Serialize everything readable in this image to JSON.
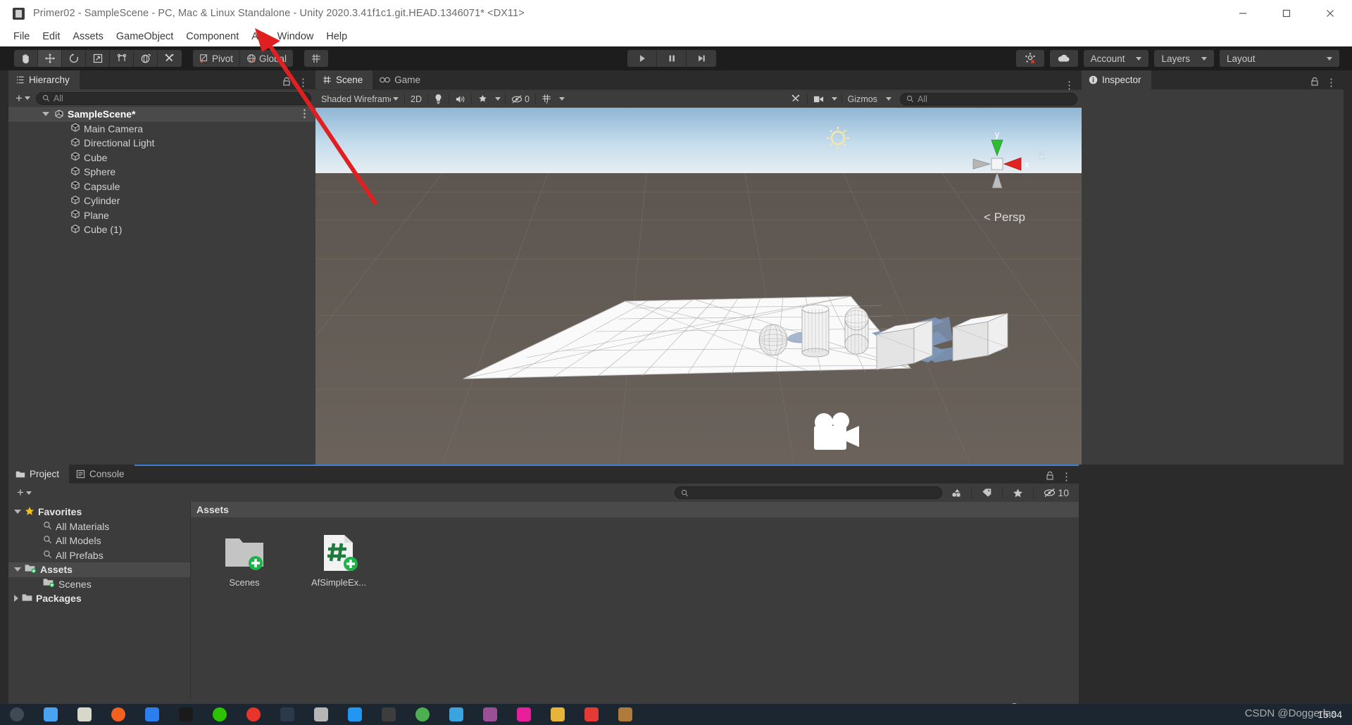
{
  "window": {
    "title": "Primer02 - SampleScene - PC, Mac & Linux Standalone - Unity 2020.3.41f1c1.git.HEAD.1346071* <DX11>",
    "minimize": "—",
    "maximize": "□",
    "close": "✕"
  },
  "menubar": {
    "items": [
      "File",
      "Edit",
      "Assets",
      "GameObject",
      "Component",
      "AF",
      "Window",
      "Help"
    ]
  },
  "toolbar": {
    "tools": [
      {
        "name": "hand-tool",
        "glyph": "✋",
        "active": false
      },
      {
        "name": "move-tool",
        "glyph": "✥",
        "active": true
      },
      {
        "name": "rotate-tool",
        "glyph": "↺",
        "active": false
      },
      {
        "name": "scale-tool",
        "glyph": "⤡",
        "active": false
      },
      {
        "name": "rect-tool",
        "glyph": "□",
        "active": false
      },
      {
        "name": "transform-tool",
        "glyph": "⊕",
        "active": false
      },
      {
        "name": "custom-tool",
        "glyph": "⚒",
        "active": false
      }
    ],
    "pivot_label": "Pivot",
    "global_label": "Global",
    "grid_snap_label": "",
    "play_label": "▶",
    "pause_label": "‖",
    "step_label": "▶|",
    "collab_label": "",
    "cloud_label": "",
    "account_label": "Account",
    "layers_label": "Layers",
    "layout_label": "Layout"
  },
  "hierarchy": {
    "tab_label": "Hierarchy",
    "search_placeholder": "All",
    "add_label": "+",
    "scene_name": "SampleScene*",
    "objects": [
      "Main Camera",
      "Directional Light",
      "Cube",
      "Sphere",
      "Capsule",
      "Cylinder",
      "Plane",
      "Cube (1)"
    ]
  },
  "scene": {
    "tabs": [
      {
        "label": "Scene",
        "icon": "grid-icon",
        "active": true
      },
      {
        "label": "Game",
        "icon": "gamepad-icon",
        "active": false
      }
    ],
    "draw_mode": "Shaded Wireframe",
    "mode_2d": "2D",
    "gizmo_count": "0",
    "gizmos_label": "Gizmos",
    "search_placeholder": "All",
    "axis_y_label": "y",
    "axis_x_label": "x",
    "perspective_label": "< Persp"
  },
  "inspector": {
    "tab_label": "Inspector"
  },
  "project": {
    "tabs": [
      {
        "label": "Project",
        "icon": "folder-icon",
        "active": true
      },
      {
        "label": "Console",
        "icon": "console-icon",
        "active": false
      }
    ],
    "add_label": "+",
    "search_placeholder": "",
    "visible_count": "10",
    "tree": [
      {
        "label": "Favorites",
        "depth": 0,
        "icon": "star-icon",
        "expanded": true,
        "bold": true,
        "selected": false
      },
      {
        "label": "All Materials",
        "depth": 1,
        "icon": "search-icon",
        "expanded": null,
        "bold": false,
        "selected": false
      },
      {
        "label": "All Models",
        "depth": 1,
        "icon": "search-icon",
        "expanded": null,
        "bold": false,
        "selected": false
      },
      {
        "label": "All Prefabs",
        "depth": 1,
        "icon": "search-icon",
        "expanded": null,
        "bold": false,
        "selected": false
      },
      {
        "label": "Assets",
        "depth": 0,
        "icon": "folder-plus-icon",
        "expanded": true,
        "bold": true,
        "selected": true
      },
      {
        "label": "Scenes",
        "depth": 1,
        "icon": "folder-plus-icon",
        "expanded": null,
        "bold": false,
        "selected": false
      },
      {
        "label": "Packages",
        "depth": 0,
        "icon": "folder-icon",
        "expanded": false,
        "bold": true,
        "selected": false
      }
    ],
    "breadcrumb": "Assets",
    "assets": [
      {
        "label": "Scenes",
        "type": "folder"
      },
      {
        "label": "AfSimpleEx...",
        "type": "csharp-script"
      }
    ]
  },
  "taskbar": {
    "clock": "15:04",
    "watermark": "CSDN @Doggerlas",
    "icons": [
      {
        "name": "search-icon",
        "color": "#3f4a55"
      },
      {
        "name": "file-explorer-icon",
        "color": "#4aa3f0"
      },
      {
        "name": "notepad-icon",
        "color": "#d8d8c8"
      },
      {
        "name": "browser-icon",
        "color": "#f4601e"
      },
      {
        "name": "onedrive-icon",
        "color": "#2d7ff0"
      },
      {
        "name": "qq-icon",
        "color": "#1a1a1a"
      },
      {
        "name": "wechat-icon",
        "color": "#2dc100"
      },
      {
        "name": "music-icon",
        "color": "#e8352b"
      },
      {
        "name": "tool-icon",
        "color": "#2b3a4a"
      },
      {
        "name": "terminal-icon",
        "color": "#b6b6b6"
      },
      {
        "name": "vscode-icon",
        "color": "#2196f3"
      },
      {
        "name": "unity-hub-icon",
        "color": "#3d3d3d"
      },
      {
        "name": "chrome-icon",
        "color": "#4caf50"
      },
      {
        "name": "edge-icon",
        "color": "#3ba3e0"
      },
      {
        "name": "visualstudio-icon",
        "color": "#9b4f96"
      },
      {
        "name": "pink-app-icon",
        "color": "#e91e9b"
      },
      {
        "name": "folder-icon",
        "color": "#e8b339"
      },
      {
        "name": "pdf-icon",
        "color": "#e53935"
      },
      {
        "name": "image-icon",
        "color": "#b07a3a"
      }
    ],
    "tray": [
      {
        "name": "battery-icon"
      },
      {
        "name": "volume-icon"
      },
      {
        "name": "network-icon"
      }
    ]
  },
  "colors": {
    "accent": "#4a90d9",
    "panel_bg": "#3c3c3c",
    "toolbar_bg": "#1d1d1d",
    "annotation_red": "#e02020",
    "asset_badge_green": "#1eb24b"
  }
}
